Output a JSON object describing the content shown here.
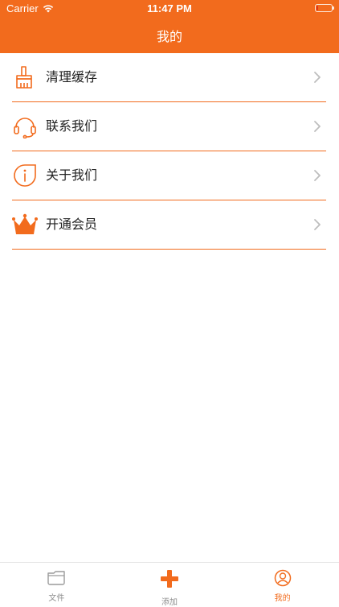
{
  "status_bar": {
    "carrier": "Carrier",
    "time": "11:47 PM",
    "battery_level": 0.05
  },
  "header": {
    "title": "我的"
  },
  "menu": {
    "items": [
      {
        "label": "清理缓存",
        "icon": "broom-icon"
      },
      {
        "label": "联系我们",
        "icon": "headset-icon"
      },
      {
        "label": "关于我们",
        "icon": "info-icon"
      },
      {
        "label": "开通会员",
        "icon": "crown-icon"
      }
    ]
  },
  "tabbar": {
    "tabs": [
      {
        "label": "文件",
        "icon": "folder-icon",
        "active": false
      },
      {
        "label": "添加",
        "icon": "plus-icon",
        "active": false
      },
      {
        "label": "我的",
        "icon": "profile-icon",
        "active": true
      }
    ]
  },
  "colors": {
    "accent": "#F26B1D",
    "battery_low": "#E0341B",
    "text": "#222222",
    "inactive": "#8E8E8E"
  }
}
